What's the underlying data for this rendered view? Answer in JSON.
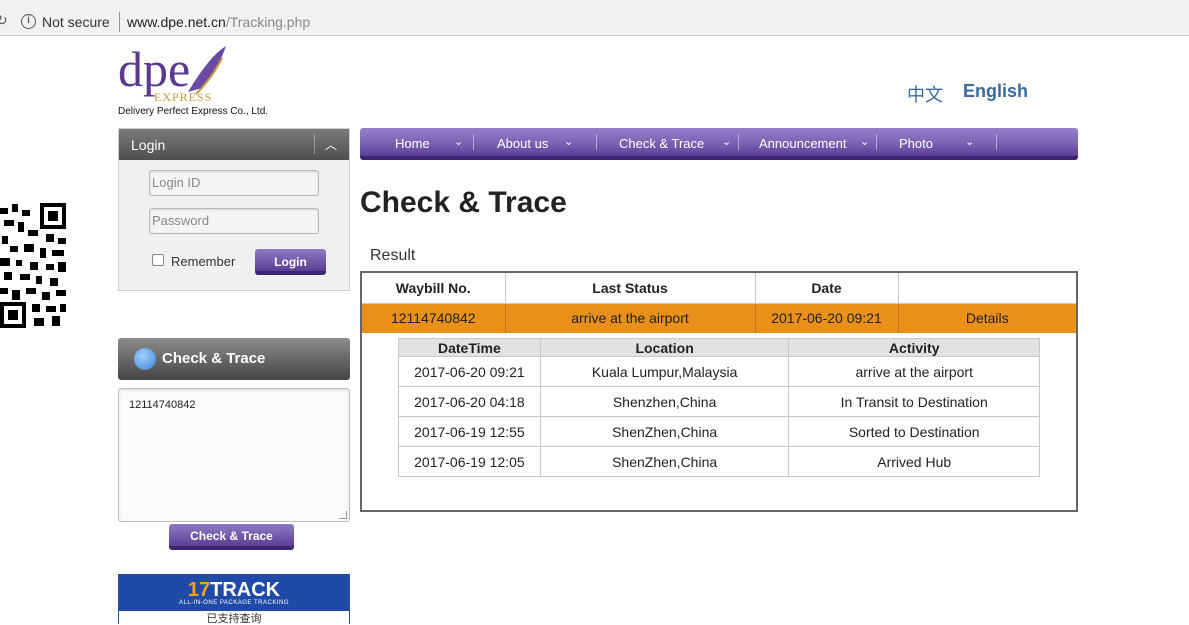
{
  "browser": {
    "security_label": "Not secure",
    "url_host": "www.dpe.net.cn",
    "url_path": "/Tracking.php"
  },
  "logo": {
    "text": "dpe",
    "sub": "EXPRESS",
    "tagline": "Delivery Perfect  Express Co., Ltd."
  },
  "languages": {
    "chinese": "中文",
    "english": "English"
  },
  "login": {
    "header": "Login",
    "login_id_placeholder": "Login ID",
    "password_placeholder": "Password",
    "remember_label": "Remember",
    "button": "Login"
  },
  "check_trace_panel": {
    "header": "Check & Trace",
    "textarea_value": "12114740842",
    "button": "Check & Trace"
  },
  "track17": {
    "logo_num": "17",
    "logo_text": "TRACK",
    "subtitle": "ALL-IN-ONE PACKAGE TRACKING",
    "bottom": "已支持查询"
  },
  "nav": {
    "items": [
      {
        "label": "Home"
      },
      {
        "label": "About us"
      },
      {
        "label": "Check & Trace"
      },
      {
        "label": "Announcement"
      },
      {
        "label": "Photo"
      }
    ]
  },
  "page": {
    "title": "Check & Trace",
    "result_label": "Result"
  },
  "result_table": {
    "headers": [
      "Waybill No.",
      "Last Status",
      "Date",
      ""
    ],
    "row": {
      "waybill": "12114740842",
      "status": "arrive at the airport",
      "date": "2017-06-20 09:21",
      "details": "Details"
    }
  },
  "detail_table": {
    "headers": [
      "DateTime",
      "Location",
      "Activity"
    ],
    "rows": [
      {
        "datetime": "2017-06-20 09:21",
        "location": "Kuala Lumpur,Malaysia",
        "activity": "arrive at the airport"
      },
      {
        "datetime": "2017-06-20 04:18",
        "location": "Shenzhen,China",
        "activity": "In Transit to Destination"
      },
      {
        "datetime": "2017-06-19 12:55",
        "location": "ShenZhen,China",
        "activity": "Sorted to Destination"
      },
      {
        "datetime": "2017-06-19 12:05",
        "location": "ShenZhen,China",
        "activity": "Arrived Hub"
      }
    ]
  },
  "colors": {
    "nav_purple": "#7a62b3",
    "result_row_orange": "#e8901a",
    "link_blue": "#3b6a9e"
  }
}
